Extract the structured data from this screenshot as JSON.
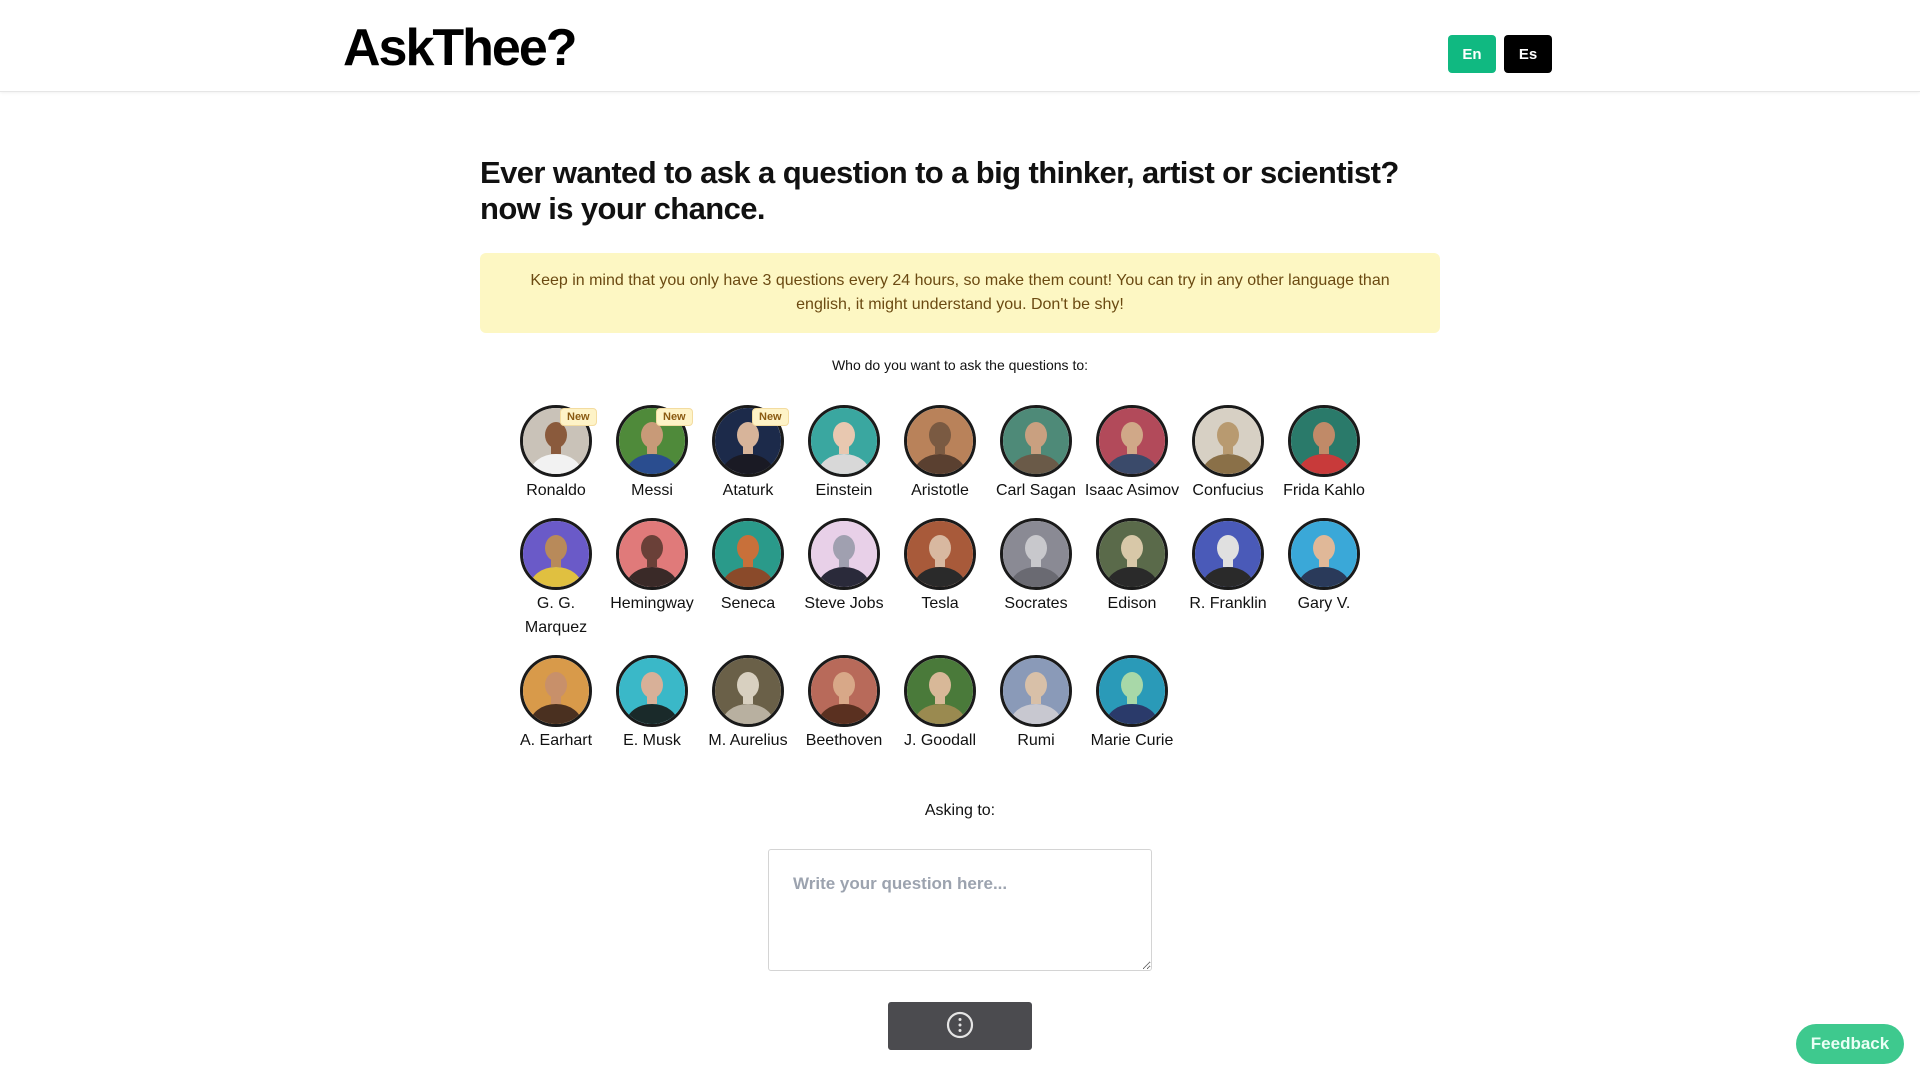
{
  "app": {
    "logo": "AskThee?"
  },
  "languages": {
    "en_label": "En",
    "es_label": "Es",
    "colors": {
      "en": "#10b981",
      "es": "#000000"
    }
  },
  "headline": "Ever wanted to ask a question to a big thinker, artist or scientist? now is your chance.",
  "notice": "Keep in mind that you only have 3 questions every 24 hours, so make them count!  You can try in any other language than english, it might understand you. Don't be shy!",
  "who_prompt": "Who do you want to ask the questions to:",
  "people": [
    {
      "name": "Ronaldo",
      "badge": "New",
      "bg": "#c9c2b8",
      "skin": "#8a5a3c",
      "cloth": "#f2f2f2"
    },
    {
      "name": "Messi",
      "badge": "New",
      "bg": "#4f8a3a",
      "skin": "#c89a78",
      "cloth": "#2a4d8f"
    },
    {
      "name": "Ataturk",
      "badge": "New",
      "bg": "#1c2a4a",
      "skin": "#d7b49a",
      "cloth": "#1a1a24"
    },
    {
      "name": "Einstein",
      "badge": "",
      "bg": "#3aa7a0",
      "skin": "#e8c8b0",
      "cloth": "#d8d8d8"
    },
    {
      "name": "Aristotle",
      "badge": "",
      "bg": "#b9825a",
      "skin": "#7a5a42",
      "cloth": "#5a4030"
    },
    {
      "name": "Carl Sagan",
      "badge": "",
      "bg": "#4e8a78",
      "skin": "#c9a080",
      "cloth": "#6a5a48"
    },
    {
      "name": "Isaac Asimov",
      "badge": "",
      "bg": "#b24a5a",
      "skin": "#d0a888",
      "cloth": "#3a4a6a"
    },
    {
      "name": "Confucius",
      "badge": "",
      "bg": "#d7d0c4",
      "skin": "#b89a70",
      "cloth": "#8a7048"
    },
    {
      "name": "Frida Kahlo",
      "badge": "",
      "bg": "#2a7a6a",
      "skin": "#c08a68",
      "cloth": "#c83a3a"
    },
    {
      "name": "G. G. Marquez",
      "badge": "",
      "bg": "#6a5ac8",
      "skin": "#b88a5a",
      "cloth": "#e0c040"
    },
    {
      "name": "Hemingway",
      "badge": "",
      "bg": "#e07a7a",
      "skin": "#6a4038",
      "cloth": "#3a2a28"
    },
    {
      "name": "Seneca",
      "badge": "",
      "bg": "#2a9a8a",
      "skin": "#c8703a",
      "cloth": "#8a4a2a"
    },
    {
      "name": "Steve Jobs",
      "badge": "",
      "bg": "#e8d0e8",
      "skin": "#a0a0b0",
      "cloth": "#2a2a3a"
    },
    {
      "name": "Tesla",
      "badge": "",
      "bg": "#a85a3a",
      "skin": "#d8b8a0",
      "cloth": "#2a2a2a"
    },
    {
      "name": "Socrates",
      "badge": "",
      "bg": "#8a8a94",
      "skin": "#c8c8cc",
      "cloth": "#6a6a72"
    },
    {
      "name": "Edison",
      "badge": "",
      "bg": "#5a6a4a",
      "skin": "#d8c8a8",
      "cloth": "#2a2a2a"
    },
    {
      "name": "R. Franklin",
      "badge": "",
      "bg": "#4a5ab8",
      "skin": "#e0e0e0",
      "cloth": "#2a2a2a"
    },
    {
      "name": "Gary V.",
      "badge": "",
      "bg": "#3aa8d8",
      "skin": "#e0b898",
      "cloth": "#2a3a5a"
    },
    {
      "name": "A. Earhart",
      "badge": "",
      "bg": "#d89a4a",
      "skin": "#c8906a",
      "cloth": "#4a3020"
    },
    {
      "name": "E. Musk",
      "badge": "",
      "bg": "#3ab8c8",
      "skin": "#d8b098",
      "cloth": "#1a2a2a"
    },
    {
      "name": "M. Aurelius",
      "badge": "",
      "bg": "#6a6048",
      "skin": "#d8d0c0",
      "cloth": "#b8b0a0"
    },
    {
      "name": "Beethoven",
      "badge": "",
      "bg": "#b86a5a",
      "skin": "#d8a888",
      "cloth": "#5a3020"
    },
    {
      "name": "J. Goodall",
      "badge": "",
      "bg": "#4a7a3a",
      "skin": "#d8b898",
      "cloth": "#9a8a50"
    },
    {
      "name": "Rumi",
      "badge": "",
      "bg": "#8a9ab8",
      "skin": "#d8c0a8",
      "cloth": "#c8c8d0"
    },
    {
      "name": "Marie Curie",
      "badge": "",
      "bg": "#2a9ab8",
      "skin": "#a8d8a8",
      "cloth": "#2a3a6a"
    }
  ],
  "asking_to_label": "Asking to:",
  "question": {
    "placeholder": "Write your question here...",
    "value": ""
  },
  "send_button": {
    "icon": "loading-spinner-icon"
  },
  "feedback_label": "Feedback"
}
